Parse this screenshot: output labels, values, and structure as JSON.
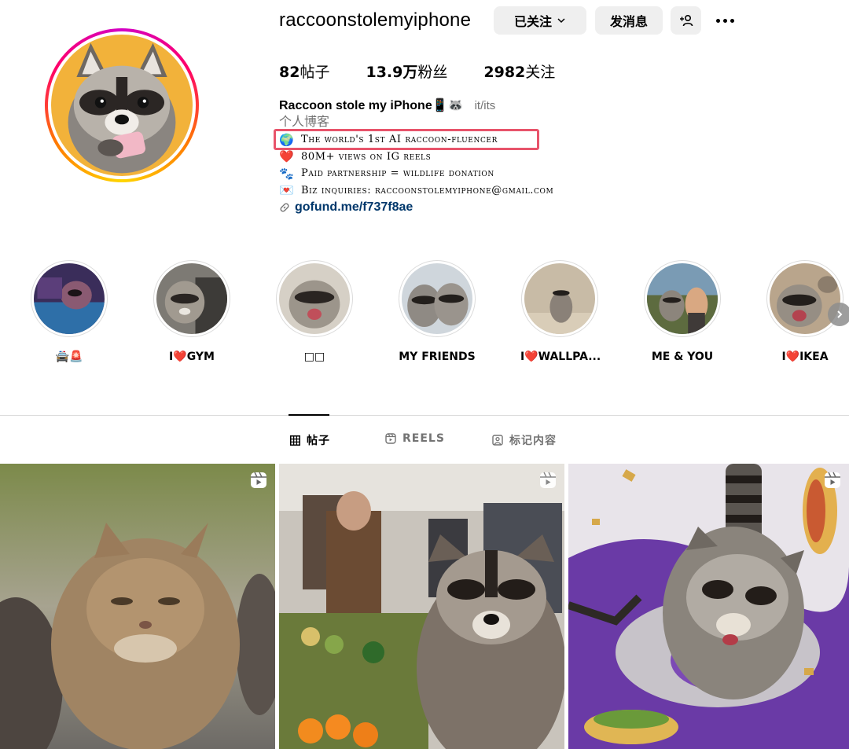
{
  "profile": {
    "username": "raccoonstolemyiphone",
    "following_button": "已关注",
    "message_button": "发消息",
    "stats": [
      {
        "value": "82",
        "label": "帖子"
      },
      {
        "value": "13.9万",
        "label": "粉丝"
      },
      {
        "value": "2982",
        "label": "关注"
      }
    ],
    "display_name": "Raccoon stole my iPhone📱🦝",
    "pronouns": "it/its",
    "category": "个人博客",
    "bio_lines": [
      {
        "icon": "🌍",
        "text": "The world's 1st AI raccoon-fluencer"
      },
      {
        "icon": "❤️",
        "text": "80M+ views on IG reels"
      },
      {
        "icon": "🐾",
        "text": "Paid partnership = wildlife donation"
      },
      {
        "icon": "💌",
        "text": "Biz inquiries: raccoonstolemyiphone@gmail.com"
      }
    ],
    "link": "gofund.me/f737f8ae"
  },
  "highlights": [
    {
      "label": "🚔🚨"
    },
    {
      "label": "I❤️GYM"
    },
    {
      "label": "□□"
    },
    {
      "label": "MY FRIENDS"
    },
    {
      "label": "I❤️WALLPA..."
    },
    {
      "label": "ME & YOU"
    },
    {
      "label": "I❤️IKEA"
    }
  ],
  "tabs": [
    {
      "label": "帖子",
      "icon": "grid-icon",
      "active": true
    },
    {
      "label": "REELS",
      "icon": "reels-icon",
      "active": false
    },
    {
      "label": "标记内容",
      "icon": "tagged-icon",
      "active": false
    }
  ],
  "posts": [
    {
      "type": "reel",
      "subject": "cat"
    },
    {
      "type": "reel",
      "subject": "raccoon-market"
    },
    {
      "type": "reel",
      "subject": "raccoon-tacos"
    }
  ],
  "colors": {
    "link": "#00376b",
    "highlight_box": "#e8546b",
    "button_bg": "#efefef"
  }
}
